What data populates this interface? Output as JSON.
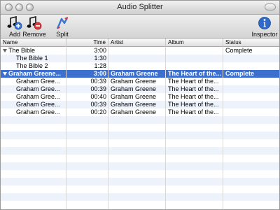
{
  "window": {
    "title": "Audio Splitter"
  },
  "toolbar": {
    "add_label": "Add",
    "remove_label": "Remove",
    "split_label": "Split",
    "inspector_label": "Inspector"
  },
  "columns": {
    "name": "Name",
    "time": "Time",
    "artist": "Artist",
    "album": "Album",
    "status": "Status"
  },
  "rows": [
    {
      "name": "The Bible",
      "time": "3:00",
      "artist": "",
      "album": "",
      "status": "Complete"
    },
    {
      "name": "The Bible  1",
      "time": "1:30",
      "artist": "",
      "album": "",
      "status": ""
    },
    {
      "name": "The Bible  2",
      "time": "1:28",
      "artist": "",
      "album": "",
      "status": ""
    },
    {
      "name": "Graham Greene...",
      "time": "3:00",
      "artist": "Graham Greene",
      "album": "The Heart of the...",
      "status": "Complete"
    },
    {
      "name": "Graham Gree...",
      "time": "00:39",
      "artist": "Graham Greene",
      "album": "The Heart of the...",
      "status": ""
    },
    {
      "name": "Graham Gree...",
      "time": "00:39",
      "artist": "Graham Greene",
      "album": "The Heart of the...",
      "status": ""
    },
    {
      "name": "Graham Gree...",
      "time": "00:40",
      "artist": "Graham Greene",
      "album": "The Heart of the...",
      "status": ""
    },
    {
      "name": "Graham Gree...",
      "time": "00:39",
      "artist": "Graham Greene",
      "album": "The Heart of the...",
      "status": ""
    },
    {
      "name": "Graham Gree...",
      "time": "00:20",
      "artist": "Graham Greene",
      "album": "The Heart of the...",
      "status": ""
    }
  ],
  "icons": {
    "add": "music-note-plus-icon",
    "remove": "music-note-minus-icon",
    "split": "split-arrow-icon",
    "inspector": "info-icon"
  },
  "colors": {
    "selection": "#3d6fcf",
    "alt_row": "#eef3fb"
  }
}
